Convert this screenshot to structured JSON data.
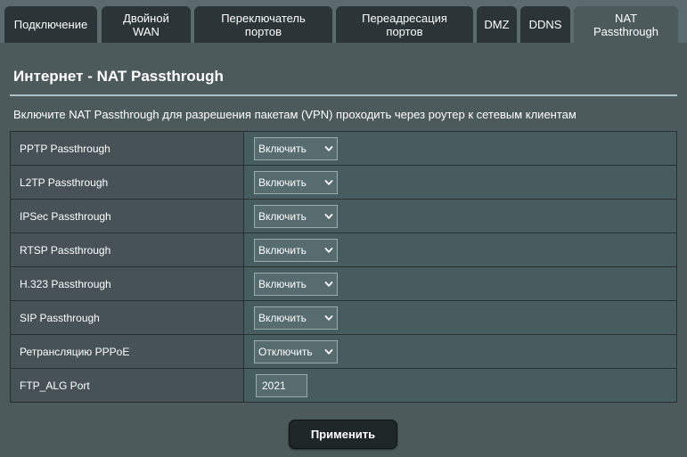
{
  "tabs": [
    {
      "label": "Подключение",
      "active": false
    },
    {
      "label": "Двойной\nWAN",
      "active": false
    },
    {
      "label": "Переключатель\nпортов",
      "active": false
    },
    {
      "label": "Переадресация\nпортов",
      "active": false
    },
    {
      "label": "DMZ",
      "active": false
    },
    {
      "label": "DDNS",
      "active": false
    },
    {
      "label": "NAT\nPassthrough",
      "active": true
    }
  ],
  "page": {
    "title": "Интернет - NAT Passthrough",
    "description": "Включите NAT Passthrough для разрешения пакетам (VPN) проходить через роутер к сетевым клиентам"
  },
  "settings": [
    {
      "label": "PPTP Passthrough",
      "value": "Включить"
    },
    {
      "label": "L2TP Passthrough",
      "value": "Включить"
    },
    {
      "label": "IPSec Passthrough",
      "value": "Включить"
    },
    {
      "label": "RTSP Passthrough",
      "value": "Включить"
    },
    {
      "label": "H.323 Passthrough",
      "value": "Включить"
    },
    {
      "label": "SIP Passthrough",
      "value": "Включить"
    },
    {
      "label": "Ретрансляцию PPPoE",
      "value": "Отключить"
    }
  ],
  "ftp_alg": {
    "label": "FTP_ALG Port",
    "value": "2021"
  },
  "apply_label": "Применить",
  "colors": {
    "background": "#4d5a5c",
    "tab": "#2b3436",
    "accent_rule": "#a9c1c6"
  },
  "icons": {
    "select_arrow": "chevron-down-icon"
  }
}
